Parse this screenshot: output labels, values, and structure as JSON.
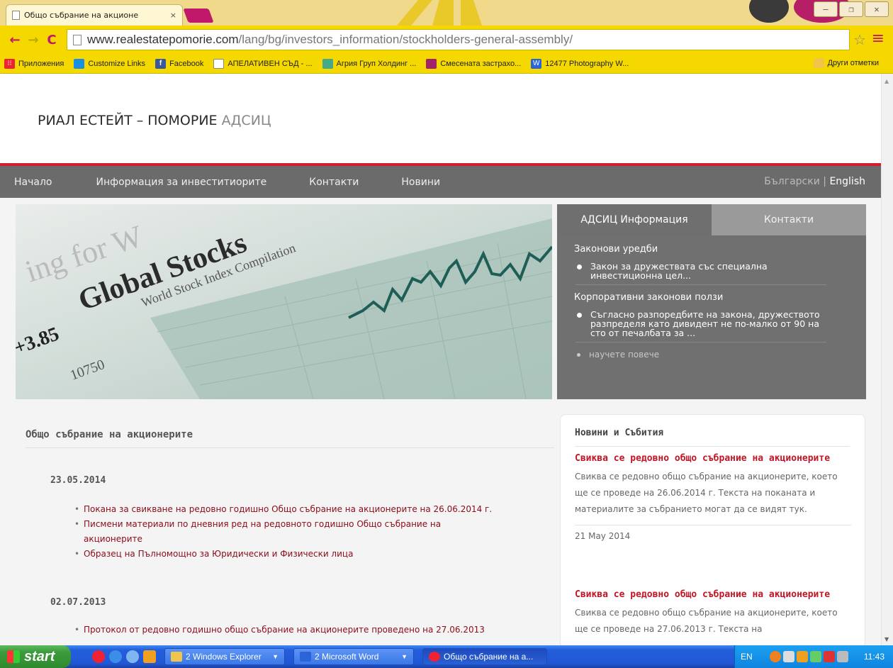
{
  "browser": {
    "tab_title": "Общо събрание на акционе",
    "tab_close": "×",
    "url_host": "www.realestatepomorie.com",
    "url_path": "/lang/bg/investors_information/stockholders-general-assembly/",
    "window_controls": [
      "–",
      "❐",
      "✕"
    ],
    "bookmarks": [
      {
        "label": "Приложения",
        "icon": "apps-icon"
      },
      {
        "label": "Customize Links",
        "icon": "windows-icon"
      },
      {
        "label": "Facebook",
        "icon": "facebook-icon"
      },
      {
        "label": "АПЕЛАТИВЕН СЪД - ...",
        "icon": "page-icon"
      },
      {
        "label": "Агрия Груп Холдинг ...",
        "icon": "agria-icon"
      },
      {
        "label": "Смесената застрахо...",
        "icon": "site-icon"
      },
      {
        "label": "12477 Photography W...",
        "icon": "wordpress-icon"
      }
    ],
    "other_bookmarks": "Други отметки"
  },
  "site": {
    "logo_main": "РИАЛ ЕСТЕЙТ – ПОМОРИЕ",
    "logo_sub": "АДСИЦ",
    "nav": [
      "Начало",
      "Информация за инвеститиорите",
      "Контакти",
      "Новини"
    ],
    "lang_bg": "Български",
    "lang_sep": " | ",
    "lang_en": "English"
  },
  "hero": {
    "caption_lines": [
      "ing for W",
      "Global Stocks",
      "World Stock Index Compilation",
      "+3.85",
      "10750"
    ]
  },
  "info_panel": {
    "tab_active": "АДСИЦ Информация",
    "tab_inactive": "Контакти",
    "section1_heading": "Законови уредби",
    "section1_item": "Закон за дружествата със специална инвестиционна цел...",
    "section2_heading": "Корпоративни законови ползи",
    "section2_item": "Съгласно разпоредбите на закона, дружеството разпределя като дивидент не по-малко от 90 на сто от печалбата за ...",
    "more": "научете повече"
  },
  "content": {
    "title": "Общо събрание на акционерите",
    "groups": [
      {
        "date": "23.05.2014",
        "docs": [
          "Покана за свикване на редовно годишно Общо събрание на акционерите на 26.06.2014 г.",
          "Писмени материали по дневния ред на редовното годишно Общо събрание на акционерите",
          "Образец на Пълномощно за Юридически и Физически лица"
        ]
      },
      {
        "date": "02.07.2013",
        "docs": [
          "Протокол от редовно годишно общо събрание на акционерите проведено на 27.06.2013"
        ]
      }
    ]
  },
  "news": {
    "heading": "Новини и Събития",
    "items": [
      {
        "title": "Свиква се редовно общо събрание на акционерите",
        "text": "Свиква се редовно общо събрание на акционерите, което ще се проведе на 26.06.2014 г. Текста на поканата и материалите за събранието могат да се видят тук.",
        "date": "21 May 2014"
      },
      {
        "title": "Свиква се редовно общо събрание на акционерите",
        "text": "Свиква се редовно общо събрание на акционерите, което ще се проведе на 27.06.2013 г. Текста на",
        "date": ""
      }
    ]
  },
  "taskbar": {
    "start": "start",
    "windows": [
      "2 Windows Explorer",
      "2 Microsoft Word",
      "Общо събрание на а..."
    ],
    "lang": "EN",
    "clock": "11:43"
  },
  "colors": {
    "accent_red": "#d41c2e",
    "link_red": "#8b0c1a",
    "nav_gray": "#6b6b6b",
    "chrome_yellow": "#f5d800"
  }
}
